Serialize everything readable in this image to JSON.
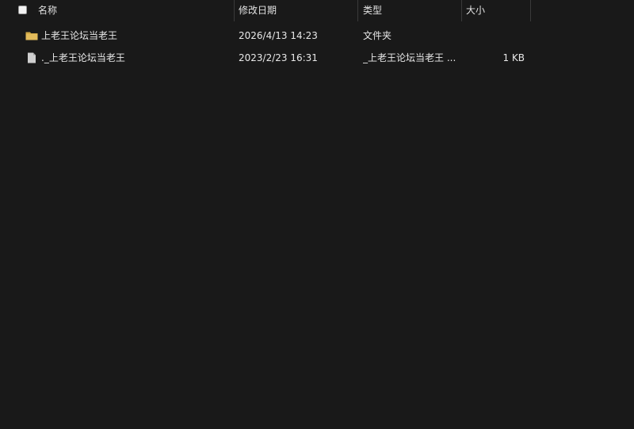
{
  "columns": {
    "name": "名称",
    "modified": "修改日期",
    "type": "类型",
    "size": "大小"
  },
  "files": [
    {
      "name": "上老王论坛当老王",
      "modified": "2026/4/13 14:23",
      "type": "文件夹",
      "size": "",
      "icon": "folder-icon"
    },
    {
      "name": "._上老王论坛当老王",
      "modified": "2023/2/23 16:31",
      "type": "_上老王论坛当老王 ...",
      "size": "1 KB",
      "icon": "file-icon"
    }
  ],
  "colors": {
    "background": "#191919",
    "folder": "#d1a945",
    "text": "#e8e8e8"
  }
}
